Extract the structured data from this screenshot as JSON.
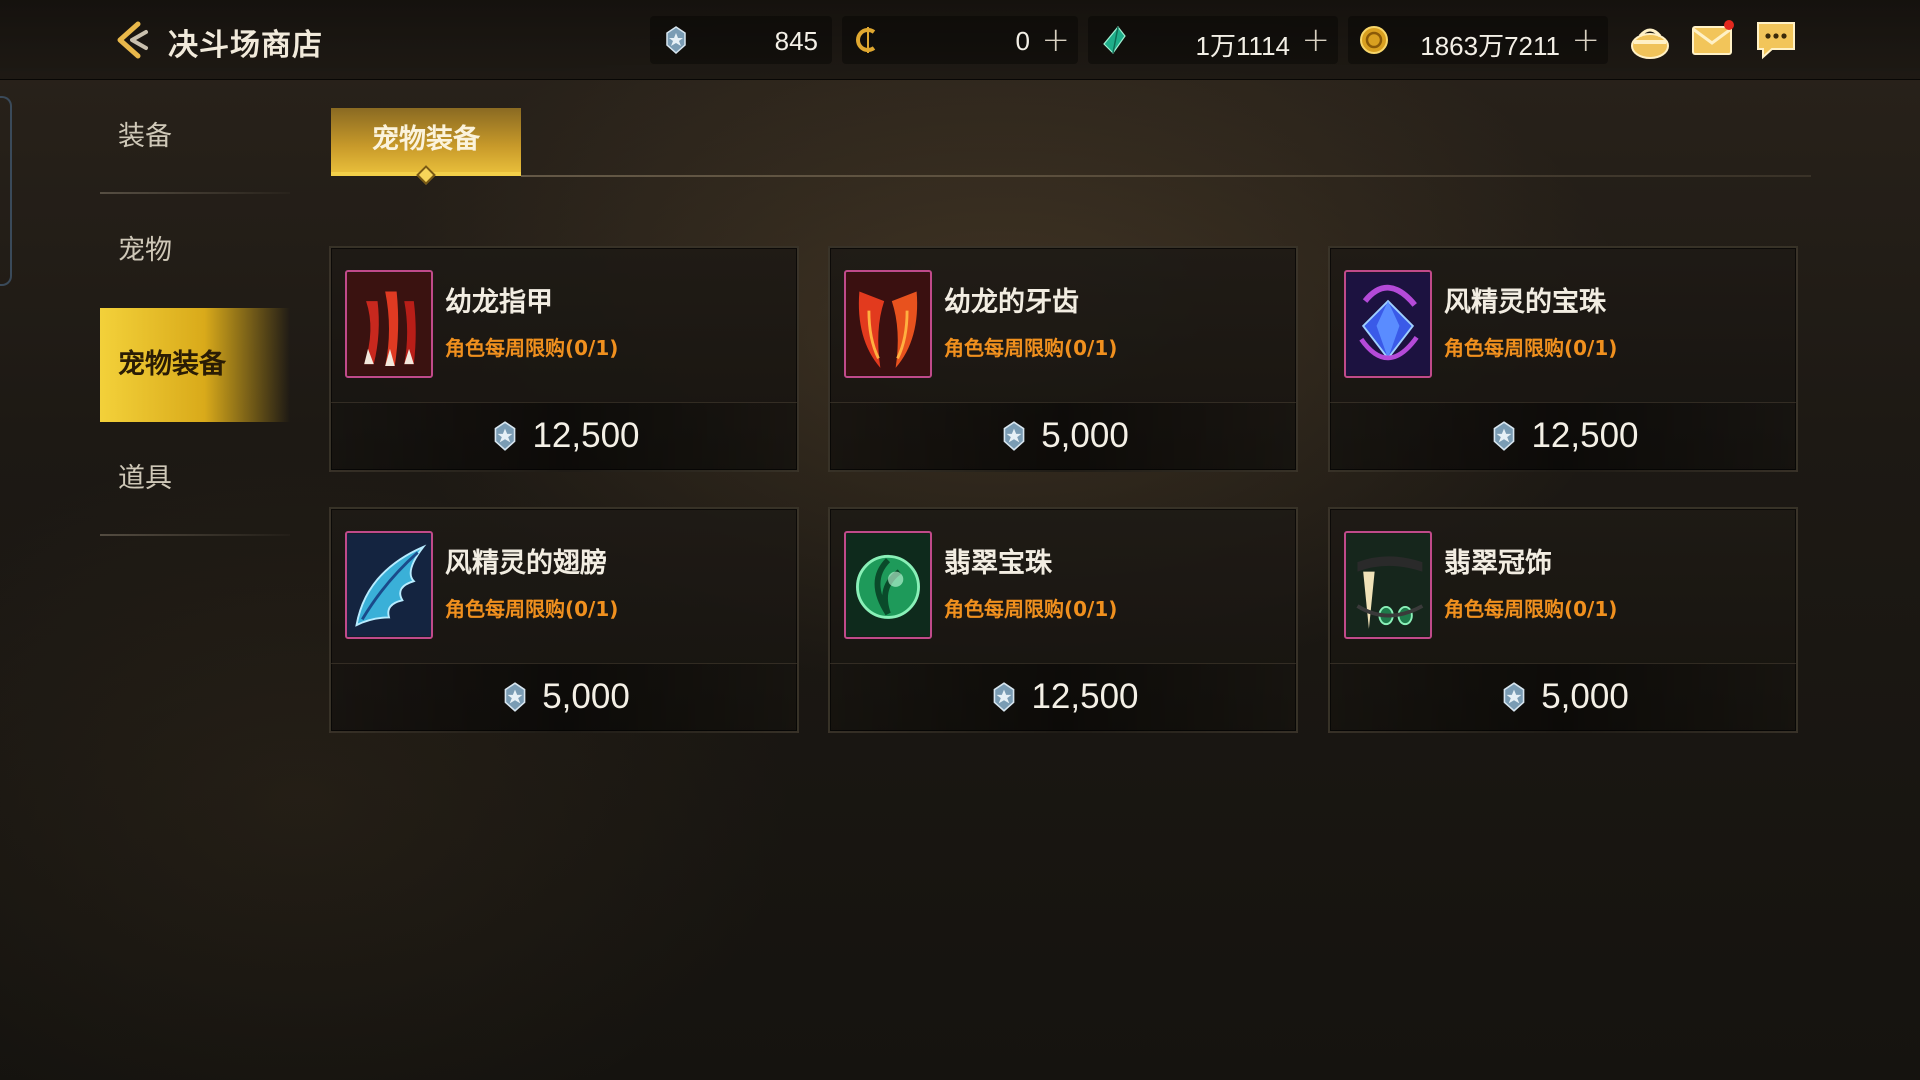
{
  "header": {
    "title": "决斗场商店",
    "currencies": [
      {
        "icon": "arena-medal-icon",
        "value": "845",
        "has_plus": false
      },
      {
        "icon": "c-coin-icon",
        "value": "0",
        "has_plus": true
      },
      {
        "icon": "green-crystal-icon",
        "value": "1万1114",
        "has_plus": true
      },
      {
        "icon": "gold-coin-icon",
        "value": "1863万7211",
        "has_plus": true
      }
    ],
    "icons": [
      "bag-icon",
      "mail-icon",
      "chat-icon"
    ]
  },
  "sidebar": {
    "items": [
      {
        "label": "装备",
        "active": false
      },
      {
        "label": "宠物",
        "active": false
      },
      {
        "label": "宠物装备",
        "active": true
      },
      {
        "label": "道具",
        "active": false
      }
    ]
  },
  "subtabs": [
    {
      "label": "宠物装备",
      "active": true
    }
  ],
  "products": [
    {
      "name": "幼龙指甲",
      "limit": "角色每周限购(0/1)",
      "price": "12,500",
      "icon": "dragon-claw-icon"
    },
    {
      "name": "幼龙的牙齿",
      "limit": "角色每周限购(0/1)",
      "price": "5,000",
      "icon": "dragon-fang-icon"
    },
    {
      "name": "风精灵的宝珠",
      "limit": "角色每周限购(0/1)",
      "price": "12,500",
      "icon": "wind-orb-icon"
    },
    {
      "name": "风精灵的翅膀",
      "limit": "角色每周限购(0/1)",
      "price": "5,000",
      "icon": "wind-wing-icon"
    },
    {
      "name": "翡翠宝珠",
      "limit": "角色每周限购(0/1)",
      "price": "12,500",
      "icon": "emerald-orb-icon"
    },
    {
      "name": "翡翠冠饰",
      "limit": "角色每周限购(0/1)",
      "price": "5,000",
      "icon": "emerald-crown-icon"
    }
  ],
  "colors": {
    "accent_gold": "#f3d13a",
    "limit_orange": "#f0901e",
    "thumb_border": "#c04a8a"
  }
}
